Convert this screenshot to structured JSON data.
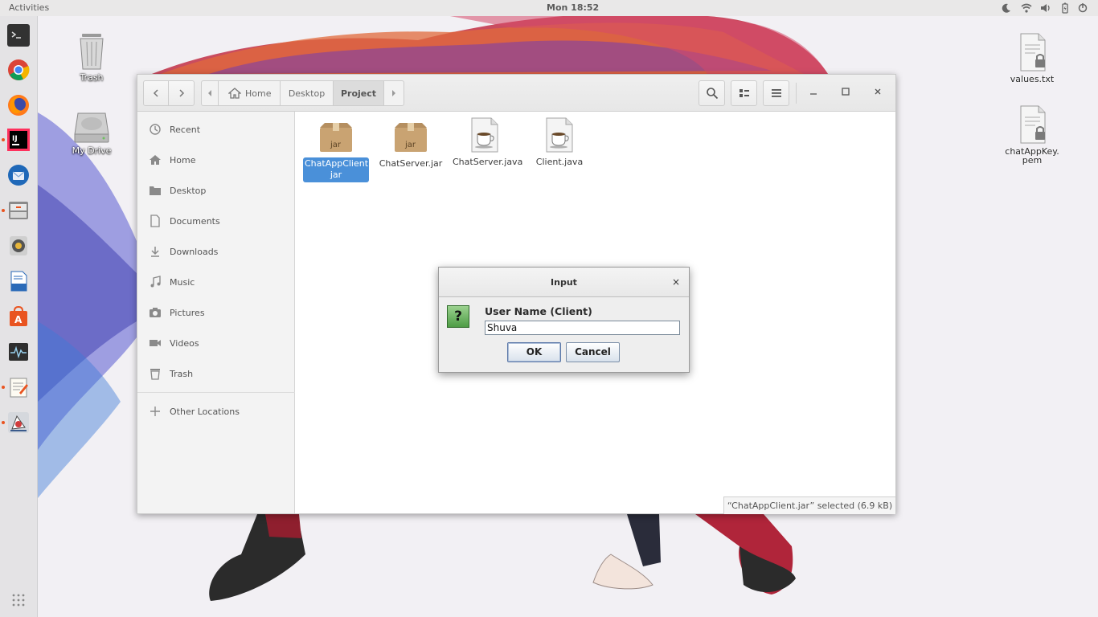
{
  "topbar": {
    "activities": "Activities",
    "clock": "Mon 18:52"
  },
  "dock": {
    "items": [
      "terminal",
      "chrome",
      "firefox",
      "intellij-idea",
      "thunderbird",
      "file-manager",
      "rhythmbox",
      "libreoffice-writer",
      "software-center",
      "system-monitor",
      "text-editor",
      "java-app",
      "show-applications"
    ]
  },
  "desktop": {
    "icons": [
      {
        "label": "Trash"
      },
      {
        "label": "My Drive"
      },
      {
        "label": "values.txt"
      },
      {
        "label": "chatAppKey.\npem"
      }
    ]
  },
  "file_manager": {
    "breadcrumb": [
      "Home",
      "Desktop",
      "Project"
    ],
    "sidebar": [
      {
        "label": "Recent",
        "icon": "clock-icon"
      },
      {
        "label": "Home",
        "icon": "home-icon"
      },
      {
        "label": "Desktop",
        "icon": "folder-icon"
      },
      {
        "label": "Documents",
        "icon": "document-icon"
      },
      {
        "label": "Downloads",
        "icon": "download-icon"
      },
      {
        "label": "Music",
        "icon": "music-icon"
      },
      {
        "label": "Pictures",
        "icon": "camera-icon"
      },
      {
        "label": "Videos",
        "icon": "video-icon"
      },
      {
        "label": "Trash",
        "icon": "trash-icon"
      },
      {
        "label": "Other Locations",
        "icon": "plus-icon"
      }
    ],
    "files": [
      {
        "name": "ChatAppClient.\njar",
        "type": "jar",
        "selected": true,
        "icon_text": "jar"
      },
      {
        "name": "ChatServer.jar",
        "type": "jar",
        "selected": false,
        "icon_text": "jar"
      },
      {
        "name": "ChatServer.java",
        "type": "java",
        "selected": false
      },
      {
        "name": "Client.java",
        "type": "java",
        "selected": false
      }
    ],
    "status": "“ChatAppClient.jar” selected  (6.9 kB)"
  },
  "dialog": {
    "title": "Input",
    "close": "×",
    "icon_glyph": "?",
    "prompt": "User Name (Client)",
    "input_value": "Shuva",
    "ok_label": "OK",
    "cancel_label": "Cancel"
  },
  "colors": {
    "accent": "#4a90d9",
    "ubuntu_orange": "#e95420",
    "topbar": "#e9e8e8"
  }
}
